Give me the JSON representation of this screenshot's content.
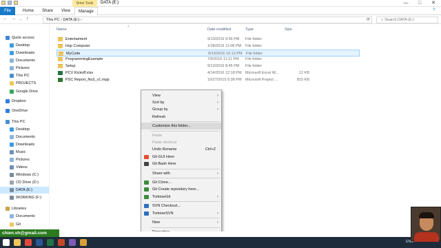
{
  "window": {
    "title": "DATA (E:)",
    "context_tab": "Drive Tools",
    "controls": {
      "minimize": "—",
      "maximize": "□",
      "close": "✕"
    }
  },
  "ribbon": {
    "tabs": [
      "File",
      "Home",
      "Share",
      "View",
      "Manage"
    ]
  },
  "address": {
    "path": "This PC  ›  DATA (E:)  ›",
    "search_placeholder": "Search DATA (E:)"
  },
  "nav": {
    "items": [
      {
        "label": "Quick access",
        "icon": "star-icon",
        "color": "#3d86d8"
      },
      {
        "label": "Desktop",
        "icon": "desktop-icon",
        "color": "#3b9ae0"
      },
      {
        "label": "Downloads",
        "icon": "downloads-icon",
        "color": "#3b9ae0"
      },
      {
        "label": "Documents",
        "icon": "documents-icon",
        "color": "#8ab4d8"
      },
      {
        "label": "Pictures",
        "icon": "pictures-icon",
        "color": "#8ab4d8"
      },
      {
        "label": "This PC",
        "icon": "pc-icon",
        "color": "#4a8fd0"
      },
      {
        "label": "PROJECTS",
        "icon": "folder-icon",
        "color": "#f0c65a"
      },
      {
        "label": "Google Drive",
        "icon": "google-drive-icon",
        "color": "#34a853"
      },
      {
        "label": "Dropbox",
        "icon": "dropbox-icon",
        "color": "#2d7fe3"
      },
      {
        "label": "OneDrive",
        "icon": "onedrive-icon",
        "color": "#2d7fe3"
      },
      {
        "label": "This PC",
        "icon": "pc-icon",
        "color": "#4a8fd0"
      },
      {
        "label": "Desktop",
        "icon": "desktop-icon",
        "color": "#3b9ae0"
      },
      {
        "label": "Documents",
        "icon": "documents-icon",
        "color": "#8ab4d8"
      },
      {
        "label": "Downloads",
        "icon": "downloads-icon",
        "color": "#3b9ae0"
      },
      {
        "label": "Music",
        "icon": "music-icon",
        "color": "#6d8fb8"
      },
      {
        "label": "Pictures",
        "icon": "pictures-icon",
        "color": "#8ab4d8"
      },
      {
        "label": "Videos",
        "icon": "videos-icon",
        "color": "#6d8fb8"
      },
      {
        "label": "Windows (C:)",
        "icon": "drive-icon",
        "color": "#7a8a9a"
      },
      {
        "label": "CD Drive (D:)",
        "icon": "cd-drive-icon",
        "color": "#9aa6b2"
      },
      {
        "label": "DATA (E:)",
        "icon": "drive-icon",
        "color": "#7a8a9a",
        "selected": true
      },
      {
        "label": "WORKING (F:)",
        "icon": "drive-icon",
        "color": "#7a8a9a"
      },
      {
        "label": "Libraries",
        "icon": "libraries-icon",
        "color": "#c9a44a"
      },
      {
        "label": "Documents",
        "icon": "documents-icon",
        "color": "#8ab4d8"
      },
      {
        "label": "Git",
        "icon": "folder-icon",
        "color": "#f0c65a"
      }
    ]
  },
  "columns": {
    "name": "Name",
    "date": "Date modified",
    "type": "Type",
    "size": "Size"
  },
  "files": [
    {
      "name": "Entertaiment",
      "date": "9/13/2016 9:56 PM",
      "type": "File folder",
      "size": "",
      "kind": "folder"
    },
    {
      "name": "Hop Computer",
      "date": "1/28/2016 11:08 PM",
      "type": "File folder",
      "size": "",
      "kind": "folder"
    },
    {
      "name": "MyCode",
      "date": "9/13/2016 10:13 PM",
      "type": "File folder",
      "size": "",
      "kind": "folder",
      "selected": true
    },
    {
      "name": "ProgrammingExample",
      "date": "7/6/2016 11:11 PM",
      "type": "File folder",
      "size": "",
      "kind": "folder"
    },
    {
      "name": "Setup",
      "date": "9/13/2016 8:45 PM",
      "type": "File folder",
      "size": "",
      "kind": "folder"
    },
    {
      "name": "PCV Kickoff.xlsx",
      "date": "4/14/2016 12:18 PM",
      "type": "Microsoft Excel W...",
      "size": "12 KB",
      "kind": "excel"
    },
    {
      "name": "PSC Report_No3_v1.mpp",
      "date": "10/27/2015 5:38 PM",
      "type": "Microsoft Project ...",
      "size": "815 KB",
      "kind": "project"
    }
  ],
  "context_menu": {
    "items": [
      {
        "label": "View",
        "arrow": true
      },
      {
        "label": "Sort by",
        "arrow": true
      },
      {
        "label": "Group by",
        "arrow": true
      },
      {
        "label": "Refresh"
      },
      {
        "sep": true
      },
      {
        "label": "Customize this folder...",
        "highlight": true
      },
      {
        "sep": true
      },
      {
        "label": "Paste",
        "disabled": true
      },
      {
        "label": "Paste shortcut",
        "disabled": true
      },
      {
        "label": "Undo Rename",
        "shortcut": "Ctrl+Z"
      },
      {
        "label": "Git GUI Here",
        "icon": "git-gui-icon",
        "color": "#e84e31"
      },
      {
        "label": "Git Bash Here",
        "icon": "git-bash-icon",
        "color": "#444"
      },
      {
        "sep": true
      },
      {
        "label": "Share with",
        "arrow": true
      },
      {
        "sep": true
      },
      {
        "label": "Git Clone...",
        "icon": "tortoisegit-icon",
        "color": "#3b8c3b"
      },
      {
        "label": "Git Create repository here...",
        "icon": "tortoisegit-icon",
        "color": "#3b8c3b"
      },
      {
        "label": "TortoiseGit",
        "icon": "tortoisegit-icon",
        "color": "#3b8c3b",
        "arrow": true
      },
      {
        "sep": true
      },
      {
        "label": "SVN Checkout...",
        "icon": "tortoisesvn-icon",
        "color": "#2e6fc0"
      },
      {
        "label": "TortoiseSVN",
        "icon": "tortoisesvn-icon",
        "color": "#2e6fc0",
        "arrow": true
      },
      {
        "sep": true
      },
      {
        "label": "New",
        "arrow": true
      },
      {
        "sep": true
      },
      {
        "label": "Properties"
      }
    ]
  },
  "taskbar": {
    "tray_text": "ENG",
    "icons": [
      {
        "name": "start-icon",
        "color": "#ffffff"
      },
      {
        "name": "file-explorer-icon",
        "color": "#f0c65a"
      },
      {
        "name": "chrome-icon",
        "color": "#e04a3b"
      },
      {
        "name": "word-icon",
        "color": "#2b5797"
      },
      {
        "name": "excel-icon",
        "color": "#217346"
      },
      {
        "name": "powerpoint-icon",
        "color": "#c5472a"
      },
      {
        "name": "app-icon",
        "color": "#7e5ab5"
      },
      {
        "name": "app-icon",
        "color": "#d8a03a"
      }
    ]
  },
  "overlay": {
    "email": "chien.vh@gmail.com"
  }
}
